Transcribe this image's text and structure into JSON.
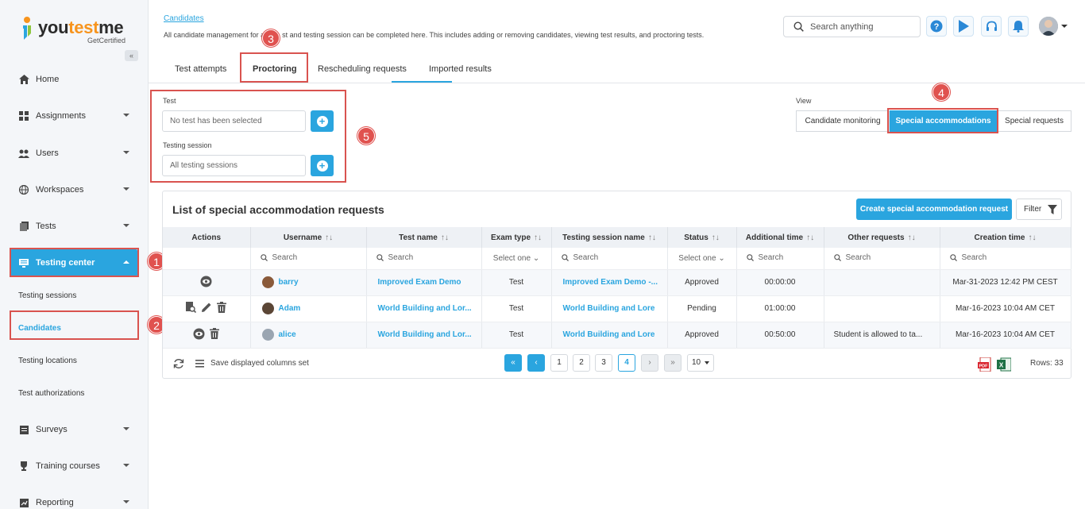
{
  "brand": {
    "name_a": "you",
    "name_b": "test",
    "name_c": "me",
    "tagline": "GetCertified"
  },
  "sidebar": {
    "items": [
      {
        "label": "Home"
      },
      {
        "label": "Assignments"
      },
      {
        "label": "Users"
      },
      {
        "label": "Workspaces"
      },
      {
        "label": "Tests"
      },
      {
        "label": "Testing center"
      },
      {
        "label": "Surveys"
      },
      {
        "label": "Training courses"
      },
      {
        "label": "Reporting"
      }
    ],
    "sub_items": [
      {
        "label": "Testing sessions"
      },
      {
        "label": "Candidates"
      },
      {
        "label": "Testing locations"
      },
      {
        "label": "Test authorizations"
      }
    ]
  },
  "header": {
    "breadcrumb": "Candidates",
    "subtitle_a": "All candidate management for a",
    "subtitle_b": "st and testing session can be completed here. This includes adding or removing candidates, viewing test results, and proctoring tests.",
    "search_placeholder": "Search anything"
  },
  "tabs": [
    {
      "label": "Test attempts"
    },
    {
      "label": "Proctoring"
    },
    {
      "label": "Rescheduling requests"
    },
    {
      "label": "Imported results"
    }
  ],
  "filters": {
    "test_label": "Test",
    "test_value": "No test has been selected",
    "session_label": "Testing session",
    "session_value": "All testing sessions"
  },
  "view": {
    "label": "View",
    "options": [
      {
        "label": "Candidate monitoring"
      },
      {
        "label": "Special accommodations"
      },
      {
        "label": "Special requests"
      }
    ]
  },
  "panel": {
    "title": "List of special accommodation requests",
    "create_label": "Create special accommodation request",
    "filter_label": "Filter"
  },
  "table": {
    "columns": [
      "Actions",
      "Username",
      "Test name",
      "Exam type",
      "Testing session name",
      "Status",
      "Additional time",
      "Other requests",
      "Creation time"
    ],
    "sort_glyph": "↑↓",
    "search_placeholder": "Search",
    "select_placeholder": "Select one",
    "rows": [
      {
        "username": "barry",
        "test": "Improved Exam Demo",
        "type": "Test",
        "session": "Improved Exam Demo -...",
        "status": "Approved",
        "time": "00:00:00",
        "other": "",
        "created": "Mar-31-2023 12:42 PM CEST"
      },
      {
        "username": "Adam",
        "test": "World Building and Lor...",
        "type": "Test",
        "session": "World Building and Lore",
        "status": "Pending",
        "time": "01:00:00",
        "other": "",
        "created": "Mar-16-2023 10:04 AM CET"
      },
      {
        "username": "alice",
        "test": "World Building and Lor...",
        "type": "Test",
        "session": "World Building and Lore",
        "status": "Approved",
        "time": "00:50:00",
        "other": "Student is allowed to ta...",
        "created": "Mar-16-2023 10:04 AM CET"
      }
    ]
  },
  "footer": {
    "save_label": "Save displayed columns set",
    "pages": [
      "1",
      "2",
      "3",
      "4"
    ],
    "rows_per_page": "10",
    "rows_count": "Rows: 33"
  },
  "annotations": [
    "1",
    "2",
    "3",
    "4",
    "5"
  ],
  "colors": {
    "accent": "#2aa5df",
    "highlight": "#d9534f"
  }
}
